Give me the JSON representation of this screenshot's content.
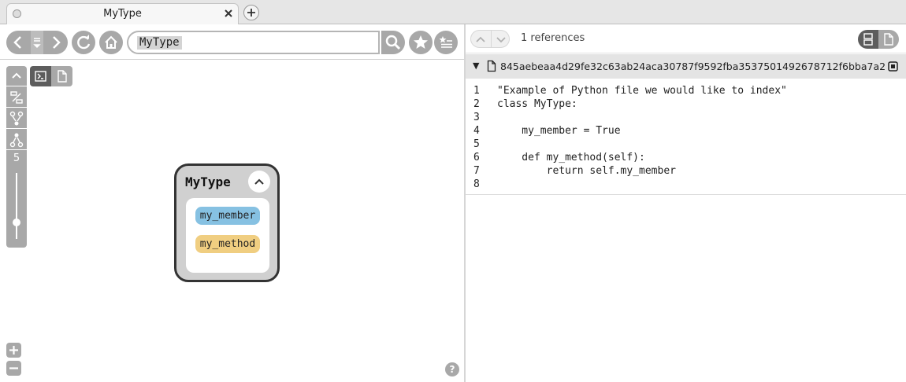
{
  "tab": {
    "title": "MyType"
  },
  "search": {
    "query": "MyType"
  },
  "graph": {
    "depth": "5",
    "depth_fraction": 0.25,
    "node": {
      "title": "MyType",
      "members": [
        {
          "label": "my_member",
          "kind": "variable",
          "color": "#86c1e2"
        },
        {
          "label": "my_method",
          "kind": "function",
          "color": "#f0ce81"
        }
      ]
    },
    "help_label": "?"
  },
  "references": {
    "count_text": "1 references"
  },
  "file": {
    "name": "845aebeaa4d29fe32c63ab24aca30787f9592fba3537501492678712f6bba7a2",
    "lines": [
      {
        "num": "1",
        "text": "\"Example of Python file we would like to index\""
      },
      {
        "num": "2",
        "text": "class MyType:"
      },
      {
        "num": "3",
        "text": ""
      },
      {
        "num": "4",
        "text": "    my_member = True"
      },
      {
        "num": "5",
        "text": ""
      },
      {
        "num": "6",
        "text": "    def my_method(self):"
      },
      {
        "num": "7",
        "text": "        return self.my_member"
      },
      {
        "num": "8",
        "text": ""
      }
    ]
  },
  "colors": {
    "button_gray": "#a8a8a8",
    "active_dark": "#5d5d5d",
    "node_border": "#333333"
  }
}
